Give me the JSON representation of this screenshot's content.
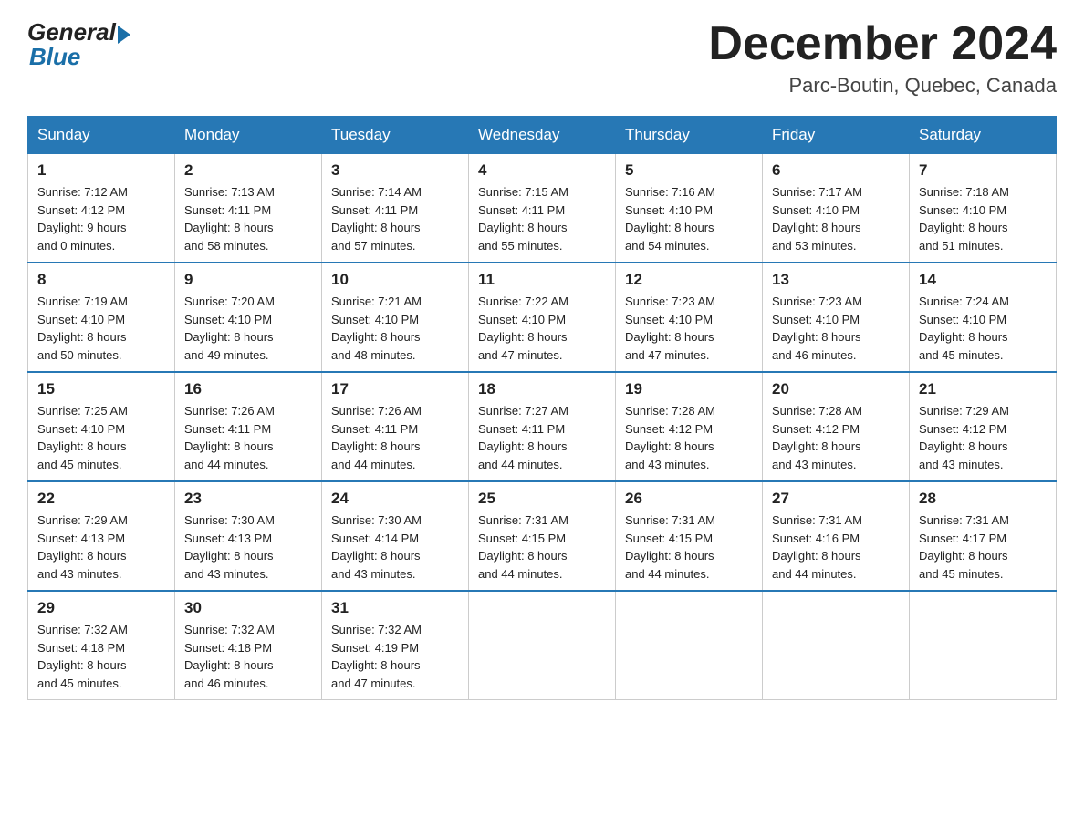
{
  "header": {
    "logo_general": "General",
    "logo_blue": "Blue",
    "month_title": "December 2024",
    "location": "Parc-Boutin, Quebec, Canada"
  },
  "weekdays": [
    "Sunday",
    "Monday",
    "Tuesday",
    "Wednesday",
    "Thursday",
    "Friday",
    "Saturday"
  ],
  "weeks": [
    [
      {
        "day": "1",
        "sunrise": "7:12 AM",
        "sunset": "4:12 PM",
        "daylight": "9 hours and 0 minutes."
      },
      {
        "day": "2",
        "sunrise": "7:13 AM",
        "sunset": "4:11 PM",
        "daylight": "8 hours and 58 minutes."
      },
      {
        "day": "3",
        "sunrise": "7:14 AM",
        "sunset": "4:11 PM",
        "daylight": "8 hours and 57 minutes."
      },
      {
        "day": "4",
        "sunrise": "7:15 AM",
        "sunset": "4:11 PM",
        "daylight": "8 hours and 55 minutes."
      },
      {
        "day": "5",
        "sunrise": "7:16 AM",
        "sunset": "4:10 PM",
        "daylight": "8 hours and 54 minutes."
      },
      {
        "day": "6",
        "sunrise": "7:17 AM",
        "sunset": "4:10 PM",
        "daylight": "8 hours and 53 minutes."
      },
      {
        "day": "7",
        "sunrise": "7:18 AM",
        "sunset": "4:10 PM",
        "daylight": "8 hours and 51 minutes."
      }
    ],
    [
      {
        "day": "8",
        "sunrise": "7:19 AM",
        "sunset": "4:10 PM",
        "daylight": "8 hours and 50 minutes."
      },
      {
        "day": "9",
        "sunrise": "7:20 AM",
        "sunset": "4:10 PM",
        "daylight": "8 hours and 49 minutes."
      },
      {
        "day": "10",
        "sunrise": "7:21 AM",
        "sunset": "4:10 PM",
        "daylight": "8 hours and 48 minutes."
      },
      {
        "day": "11",
        "sunrise": "7:22 AM",
        "sunset": "4:10 PM",
        "daylight": "8 hours and 47 minutes."
      },
      {
        "day": "12",
        "sunrise": "7:23 AM",
        "sunset": "4:10 PM",
        "daylight": "8 hours and 47 minutes."
      },
      {
        "day": "13",
        "sunrise": "7:23 AM",
        "sunset": "4:10 PM",
        "daylight": "8 hours and 46 minutes."
      },
      {
        "day": "14",
        "sunrise": "7:24 AM",
        "sunset": "4:10 PM",
        "daylight": "8 hours and 45 minutes."
      }
    ],
    [
      {
        "day": "15",
        "sunrise": "7:25 AM",
        "sunset": "4:10 PM",
        "daylight": "8 hours and 45 minutes."
      },
      {
        "day": "16",
        "sunrise": "7:26 AM",
        "sunset": "4:11 PM",
        "daylight": "8 hours and 44 minutes."
      },
      {
        "day": "17",
        "sunrise": "7:26 AM",
        "sunset": "4:11 PM",
        "daylight": "8 hours and 44 minutes."
      },
      {
        "day": "18",
        "sunrise": "7:27 AM",
        "sunset": "4:11 PM",
        "daylight": "8 hours and 44 minutes."
      },
      {
        "day": "19",
        "sunrise": "7:28 AM",
        "sunset": "4:12 PM",
        "daylight": "8 hours and 43 minutes."
      },
      {
        "day": "20",
        "sunrise": "7:28 AM",
        "sunset": "4:12 PM",
        "daylight": "8 hours and 43 minutes."
      },
      {
        "day": "21",
        "sunrise": "7:29 AM",
        "sunset": "4:12 PM",
        "daylight": "8 hours and 43 minutes."
      }
    ],
    [
      {
        "day": "22",
        "sunrise": "7:29 AM",
        "sunset": "4:13 PM",
        "daylight": "8 hours and 43 minutes."
      },
      {
        "day": "23",
        "sunrise": "7:30 AM",
        "sunset": "4:13 PM",
        "daylight": "8 hours and 43 minutes."
      },
      {
        "day": "24",
        "sunrise": "7:30 AM",
        "sunset": "4:14 PM",
        "daylight": "8 hours and 43 minutes."
      },
      {
        "day": "25",
        "sunrise": "7:31 AM",
        "sunset": "4:15 PM",
        "daylight": "8 hours and 44 minutes."
      },
      {
        "day": "26",
        "sunrise": "7:31 AM",
        "sunset": "4:15 PM",
        "daylight": "8 hours and 44 minutes."
      },
      {
        "day": "27",
        "sunrise": "7:31 AM",
        "sunset": "4:16 PM",
        "daylight": "8 hours and 44 minutes."
      },
      {
        "day": "28",
        "sunrise": "7:31 AM",
        "sunset": "4:17 PM",
        "daylight": "8 hours and 45 minutes."
      }
    ],
    [
      {
        "day": "29",
        "sunrise": "7:32 AM",
        "sunset": "4:18 PM",
        "daylight": "8 hours and 45 minutes."
      },
      {
        "day": "30",
        "sunrise": "7:32 AM",
        "sunset": "4:18 PM",
        "daylight": "8 hours and 46 minutes."
      },
      {
        "day": "31",
        "sunrise": "7:32 AM",
        "sunset": "4:19 PM",
        "daylight": "8 hours and 47 minutes."
      },
      null,
      null,
      null,
      null
    ]
  ],
  "labels": {
    "sunrise_prefix": "Sunrise: ",
    "sunset_prefix": "Sunset: ",
    "daylight_prefix": "Daylight: "
  }
}
